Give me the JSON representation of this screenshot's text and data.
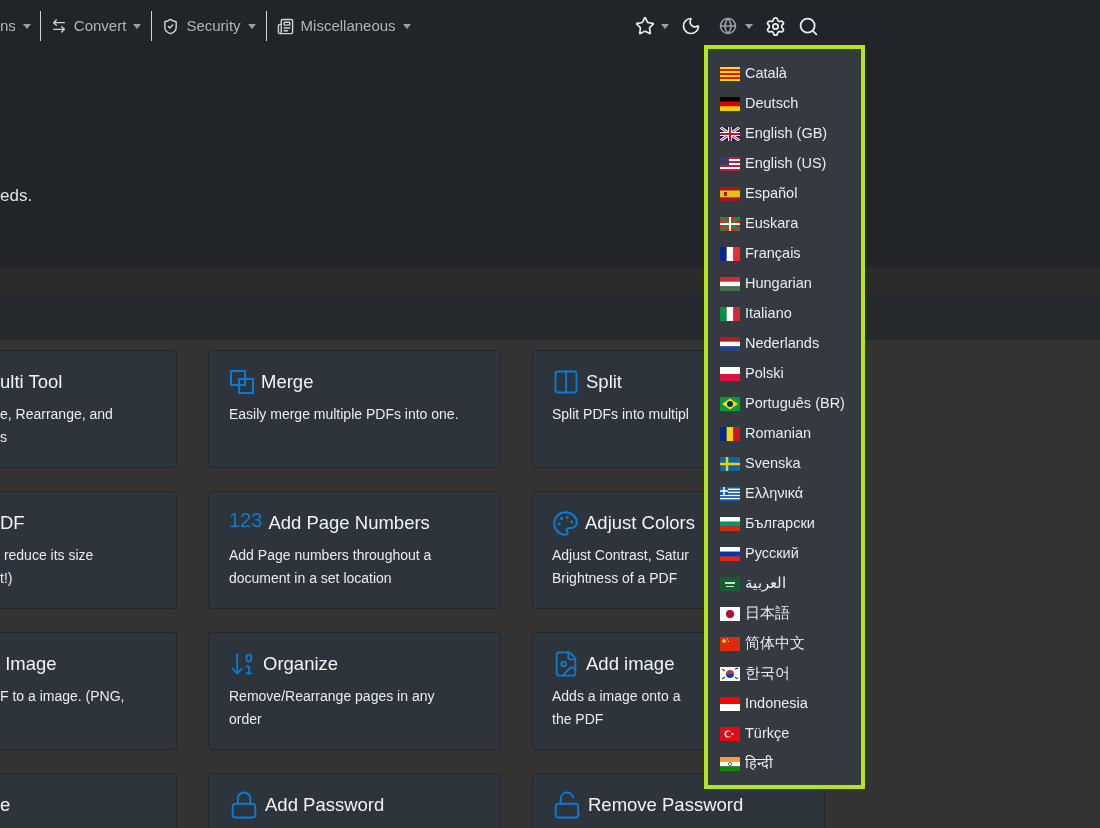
{
  "navbar": {
    "menus": [
      {
        "label": "ns"
      },
      {
        "label": "Convert"
      },
      {
        "label": "Security"
      },
      {
        "label": "Miscellaneous"
      }
    ]
  },
  "hero": {
    "text": "eds."
  },
  "tools": [
    [
      {
        "title": "ulti Tool",
        "lines": [
          "e, Rearrange, and",
          "s"
        ]
      },
      {
        "title": "Merge",
        "lines": [
          "Easily merge multiple PDFs into one."
        ]
      },
      {
        "title": "Split",
        "lines": [
          "Split PDFs into multipl"
        ]
      }
    ],
    [
      {
        "title": "DF",
        "lines": [
          " reduce its size",
          "t!)"
        ]
      },
      {
        "title": "Add Page Numbers",
        "icon_text": "123",
        "lines": [
          "Add Page numbers throughout a",
          "document in a set location"
        ]
      },
      {
        "title": "Adjust Colors",
        "lines": [
          "Adjust Contrast, Satur",
          "Brightness of a PDF"
        ]
      }
    ],
    [
      {
        "title": " Image",
        "lines": [
          "F to a image. (PNG,"
        ]
      },
      {
        "title": "Organize",
        "lines": [
          "Remove/Rearrange pages in any",
          "order"
        ]
      },
      {
        "title": "Add image",
        "lines": [
          "Adds a image onto a",
          "the PDF"
        ]
      }
    ],
    [
      {
        "title": "e"
      },
      {
        "title": "Add Password"
      },
      {
        "title": "Remove Password"
      }
    ]
  ],
  "language_menu": {
    "items": [
      "Català",
      "Deutsch",
      "English (GB)",
      "English (US)",
      "Español",
      "Euskara",
      "Français",
      "Hungarian",
      "Italiano",
      "Nederlands",
      "Polski",
      "Português (BR)",
      "Romanian",
      "Svenska",
      "Ελληνικά",
      "Български",
      "Русский",
      "العربية",
      "日本語",
      "简体中文",
      "한국어",
      "Indonesia",
      "Türkçe",
      "हिन्दी"
    ]
  }
}
